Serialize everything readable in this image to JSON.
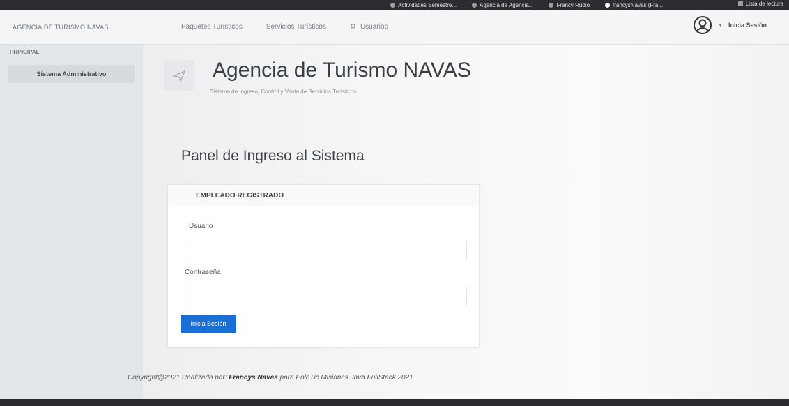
{
  "bookmarks": [
    {
      "label": "Actividades Semestre..."
    },
    {
      "label": "Agencia de Agencia..."
    },
    {
      "label": "Francy Rubio"
    },
    {
      "label": "francysNavas (Fra..."
    }
  ],
  "reading_list": "Lista de lectura",
  "navbar": {
    "brand": "AGENCIA DE TURISMO NAVAS",
    "links": [
      {
        "label": "Paquetes Turísticos"
      },
      {
        "label": "Servicios Turísticos"
      },
      {
        "label": "Usuarios"
      }
    ],
    "session_label": "Inicia Sesión"
  },
  "sidebar": {
    "heading": "PRINCIPAL",
    "items": [
      {
        "label": "Sistema Administrativo"
      }
    ]
  },
  "header": {
    "title": "Agencia de Turismo NAVAS",
    "subtitle": "Sistema de Ingreso, Control y Venta de Servicios Turísticos"
  },
  "panel": {
    "title": "Panel de Ingreso al Sistema",
    "card_title": "EMPLEADO REGISTRADO",
    "usuario_label": "Usuario",
    "usuario_value": "",
    "password_label": "Contraseña",
    "password_value": "",
    "submit_label": "Inicia Sesión"
  },
  "footer": {
    "prefix": "Copyright@2021 Realizado por: ",
    "author": "Francys Navas",
    "suffix": " para PoloTic Misiones Java FullStack 2021"
  },
  "colors": {
    "primary": "#1a6fd6"
  }
}
